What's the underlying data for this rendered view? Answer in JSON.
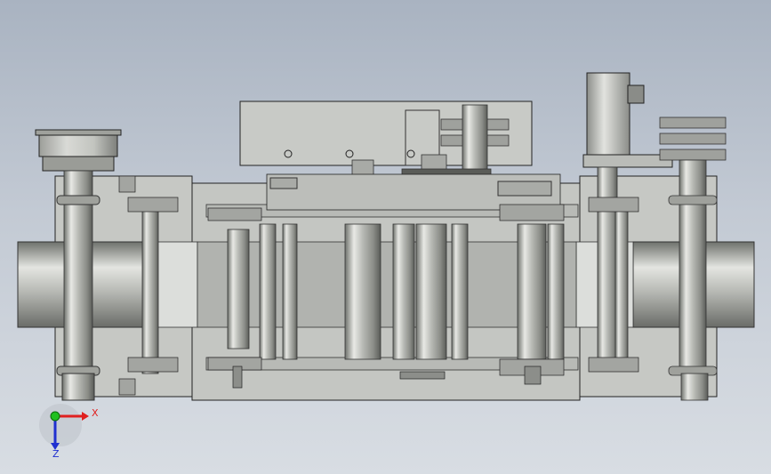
{
  "view": {
    "background_top": "#a9b3c1",
    "background_bottom": "#d8dde3",
    "part_color": "#c9cbc8",
    "edge_color": "#2a2a2a"
  },
  "triad": {
    "x_label": "X",
    "z_label": "Z",
    "x_color": "#e02020",
    "y_color": "#20c020",
    "z_color": "#2030d0"
  }
}
